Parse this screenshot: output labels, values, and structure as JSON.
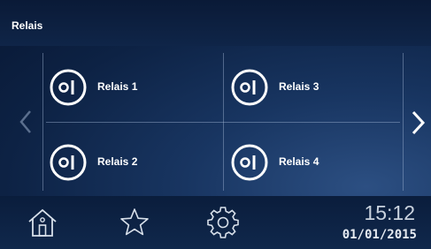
{
  "header": {
    "title": "Relais"
  },
  "relays": [
    {
      "label": "Relais 1"
    },
    {
      "label": "Relais 2"
    },
    {
      "label": "Relais 3"
    },
    {
      "label": "Relais 4"
    }
  ],
  "icons": {
    "relay": "power-toggle-icon",
    "prev": "chevron-left-icon",
    "next": "chevron-right-icon",
    "home": "home-icon",
    "favorites": "star-icon",
    "settings": "gear-icon"
  },
  "footer": {
    "time": "15:12",
    "date": "01/01/2015"
  },
  "colors": {
    "background": "#0d2244",
    "text": "#ffffff",
    "chevron-disabled": "#5b6f8e"
  }
}
